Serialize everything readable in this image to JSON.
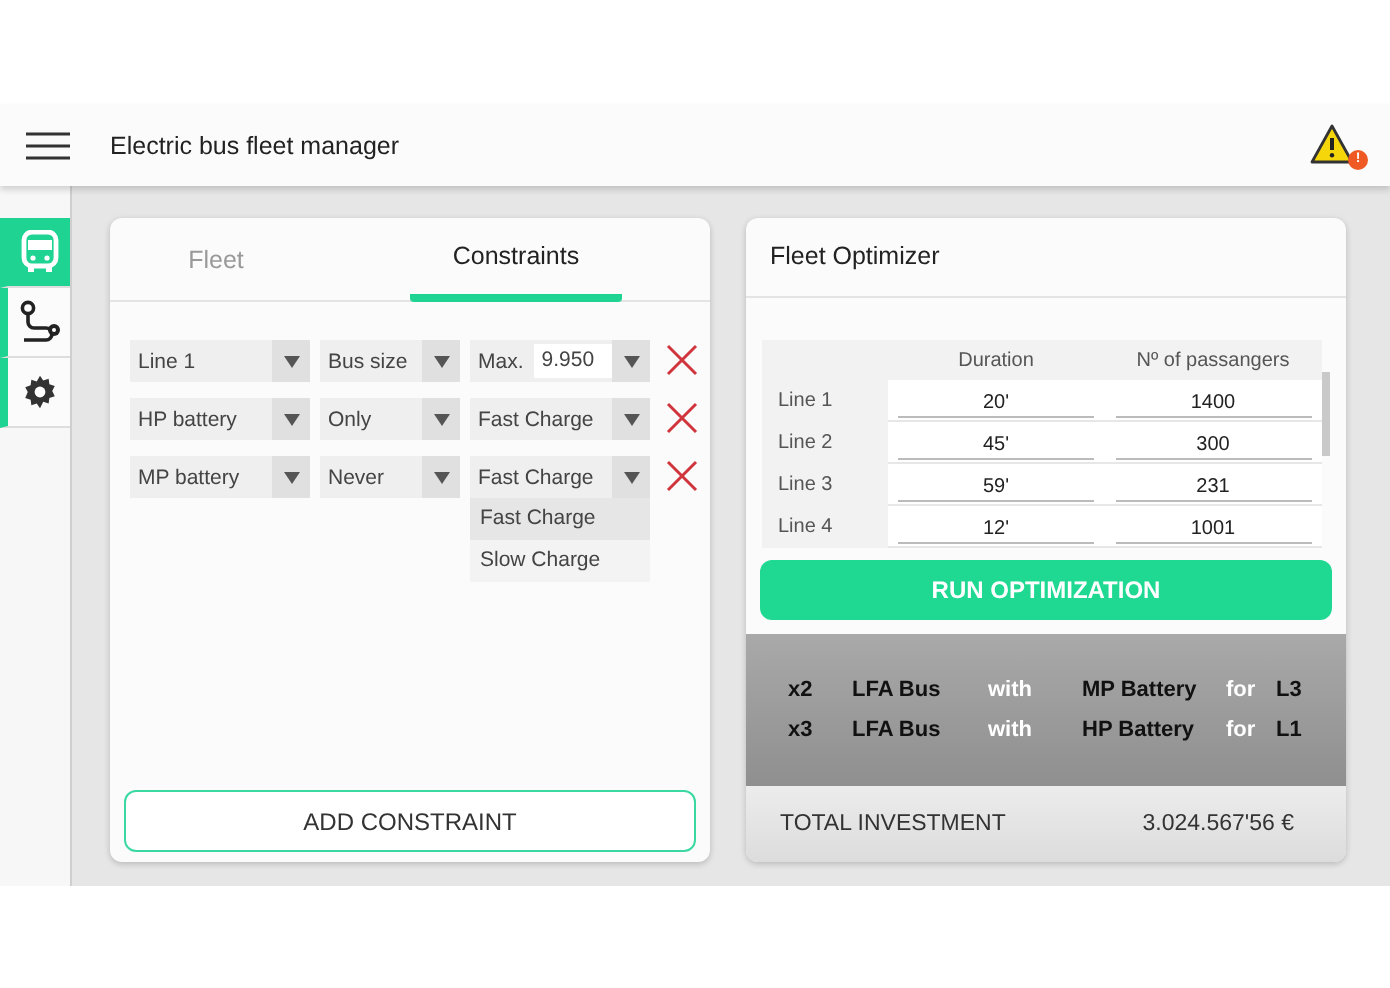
{
  "header": {
    "title": "Electric bus fleet manager",
    "alert_badge": "!"
  },
  "sidebar": {
    "items": [
      {
        "selected": true
      },
      {
        "selected": false
      },
      {
        "selected": false
      }
    ]
  },
  "constraints_panel": {
    "tabs": [
      {
        "label": "Fleet",
        "selected": false
      },
      {
        "label": "Constraints",
        "selected": true
      }
    ],
    "rows": [
      {
        "cells": [
          {
            "kind": "select",
            "value": "Line 1"
          },
          {
            "kind": "select",
            "value": "Bus size"
          },
          {
            "kind": "limit",
            "label": "Max.",
            "value": "9.950"
          }
        ]
      },
      {
        "cells": [
          {
            "kind": "select",
            "value": "HP battery"
          },
          {
            "kind": "select",
            "value": "Only"
          },
          {
            "kind": "select",
            "value": "Fast Charge"
          }
        ]
      },
      {
        "cells": [
          {
            "kind": "select",
            "value": "MP battery"
          },
          {
            "kind": "select",
            "value": "Never"
          },
          {
            "kind": "select",
            "value": "Fast Charge"
          }
        ],
        "options": [
          {
            "label": "Fast Charge",
            "selected": true
          },
          {
            "label": "Slow Charge",
            "selected": false
          }
        ]
      }
    ],
    "add_button": "ADD CONSTRAINT"
  },
  "optimizer": {
    "title": "Fleet Optimizer",
    "columns": [
      "Duration",
      "Nº of passangers"
    ],
    "rows": [
      {
        "line": "Line 1",
        "duration": "20'",
        "passengers": "1400"
      },
      {
        "line": "Line 2",
        "duration": "45'",
        "passengers": "300"
      },
      {
        "line": "Line 3",
        "duration": "59'",
        "passengers": "231"
      },
      {
        "line": "Line 4",
        "duration": "12'",
        "passengers": "1001"
      }
    ],
    "run_button": "RUN OPTIMIZATION",
    "results": [
      {
        "quantity": "x2",
        "bus": "LFA Bus",
        "with": "with",
        "battery": "MP Battery",
        "for": "for",
        "line": "L3"
      },
      {
        "quantity": "x3",
        "bus": "LFA Bus",
        "with": "with",
        "battery": "HP Battery",
        "for": "for",
        "line": "L1"
      }
    ],
    "total_label": "TOTAL INVESTMENT",
    "total_value": "3.024.567'56 €"
  }
}
